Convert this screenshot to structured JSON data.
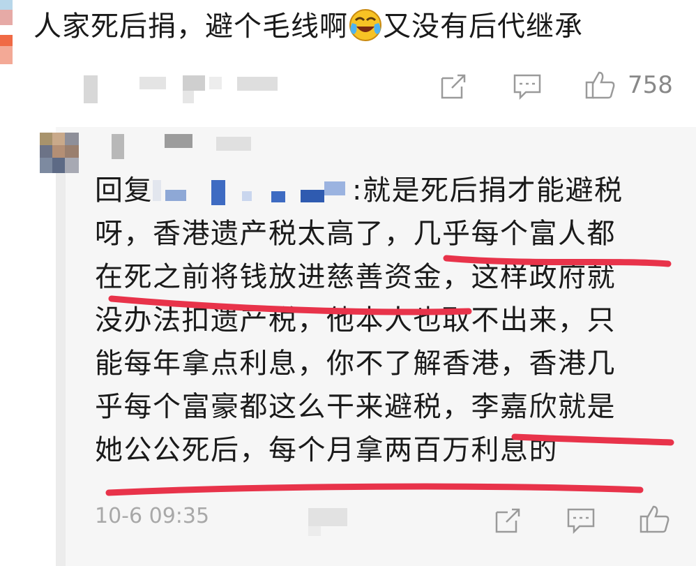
{
  "comment": {
    "text_before_emoji": "人家死后捐，避个毛线啊",
    "emoji": "laugh-cry-emoji",
    "text_after_emoji": "又没有后代继承",
    "like_count": "758"
  },
  "reply": {
    "prefix": "回复",
    "colon": ":",
    "lines": [
      "就是死后捐才能避税",
      "呀，香港遗产税太高了，几乎每个富人都",
      "在死之前将钱放进慈善资金，这样政府就",
      "没办法扣遗产税，他本人也取不出来，只",
      "能每年拿点利息，你不了解香港，香港几",
      "乎每个富豪都这么干来避税，李嘉欣就是",
      "她公公死后，每个月拿两百万利息的"
    ],
    "time": "10-6 09:35"
  },
  "colors": {
    "underline": "#e8334a",
    "muted": "#a8a8a8",
    "icon": "#9a9a9a"
  },
  "icons": [
    "share-icon",
    "comment-icon",
    "like-icon"
  ]
}
